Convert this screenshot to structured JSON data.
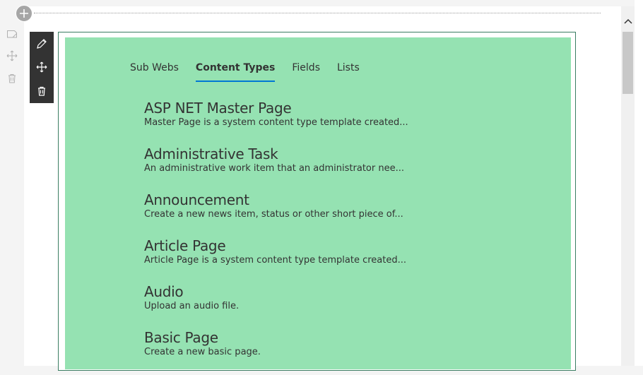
{
  "canvas": {
    "rail_icons": [
      "sticky-note-icon",
      "move-icon",
      "trash-icon"
    ],
    "add_button_icon": "plus-icon"
  },
  "toolbar": {
    "buttons": [
      {
        "icon": "pencil-icon",
        "action": "edit"
      },
      {
        "icon": "move-icon",
        "action": "move"
      },
      {
        "icon": "trash-icon",
        "action": "delete"
      }
    ]
  },
  "webpart": {
    "background": "#95e2b2",
    "border_color": "#3a7d62",
    "tabs": [
      {
        "label": "Sub Webs",
        "active": false
      },
      {
        "label": "Content Types",
        "active": true
      },
      {
        "label": "Fields",
        "active": false
      },
      {
        "label": "Lists",
        "active": false
      }
    ],
    "active_tab_underline": "#0078d4",
    "items": [
      {
        "title": "ASP NET Master Page",
        "description": "Master Page is a system content type template created..."
      },
      {
        "title": "Administrative Task",
        "description": "An administrative work item that an administrator nee..."
      },
      {
        "title": "Announcement",
        "description": "Create a new news item, status or other short piece of..."
      },
      {
        "title": "Article Page",
        "description": "Article Page is a system content type template created..."
      },
      {
        "title": "Audio",
        "description": "Upload an audio file."
      },
      {
        "title": "Basic Page",
        "description": "Create a new basic page."
      }
    ]
  },
  "scrollbar": {
    "up_icon": "chevron-up-icon"
  }
}
